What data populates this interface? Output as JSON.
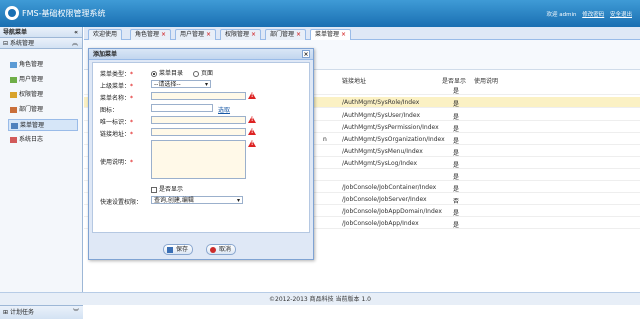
{
  "header": {
    "app_title": "FMS-基础权限管理系统",
    "welcome": "欢迎 admin",
    "modify_password": "修改密码",
    "logout": "安全退出"
  },
  "sidebar": {
    "nav_title": "导航菜单",
    "section": "系统管理",
    "items": [
      {
        "label": "角色管理",
        "icon": "role-icon"
      },
      {
        "label": "用户管理",
        "icon": "user-icon"
      },
      {
        "label": "权限管理",
        "icon": "permission-icon"
      },
      {
        "label": "部门管理",
        "icon": "department-icon"
      },
      {
        "label": "菜单管理",
        "icon": "menu-icon"
      },
      {
        "label": "系统日志",
        "icon": "log-icon"
      }
    ],
    "bottom_section": "计划任务"
  },
  "tabs": [
    {
      "label": "欢迎使用"
    },
    {
      "label": "角色管理"
    },
    {
      "label": "用户管理"
    },
    {
      "label": "权限管理"
    },
    {
      "label": "部门管理"
    },
    {
      "label": "菜单管理"
    }
  ],
  "grid": {
    "columns": [
      "链接地址",
      "是否显示",
      "使用说明"
    ],
    "rows": [
      {
        "fragment": "",
        "url": "",
        "show": "是"
      },
      {
        "fragment": "",
        "url": "/AuthMgmt/SysRole/Index",
        "show": "是"
      },
      {
        "fragment": "",
        "url": "/AuthMgmt/SysUser/Index",
        "show": "是"
      },
      {
        "fragment": "",
        "url": "/AuthMgmt/SysPermission/Index",
        "show": "是"
      },
      {
        "fragment": "n",
        "url": "/AuthMgmt/SysOrganization/Index",
        "show": "是"
      },
      {
        "fragment": "",
        "url": "/AuthMgmt/SysMenu/Index",
        "show": "是"
      },
      {
        "fragment": "",
        "url": "/AuthMgmt/SysLog/Index",
        "show": "是"
      },
      {
        "fragment": "",
        "url": "",
        "show": "是"
      },
      {
        "fragment": "",
        "url": "/JobConsole/JobContainer/Index",
        "show": "是"
      },
      {
        "fragment": "",
        "url": "/JobConsole/JobServer/Index",
        "show": "否"
      },
      {
        "fragment": "",
        "url": "/JobConsole/JobAppDomain/Index",
        "show": "是"
      },
      {
        "fragment": "",
        "url": "/JobConsole/JobApp/Index",
        "show": "是"
      }
    ]
  },
  "dialog": {
    "title": "添加菜单",
    "close": "×",
    "menu_type_label": "菜单类型：",
    "menu_type_options": [
      "菜单目录",
      "页面"
    ],
    "parent_label": "上级菜单：",
    "parent_value": "--请选择--",
    "name_label": "菜单名称：",
    "icon_label": "图标：",
    "icon_select": "选取",
    "key_label": "唯一标识：",
    "url_label": "链接地址：",
    "desc_label": "使用说明：",
    "show_label": "是否显示",
    "quick_label": "快速设置权限：",
    "quick_value": "查询,创建,编辑",
    "save": "保存",
    "cancel": "取消"
  },
  "footer": {
    "text": "©2012-2013 商品科技  当前版本 1.0"
  }
}
